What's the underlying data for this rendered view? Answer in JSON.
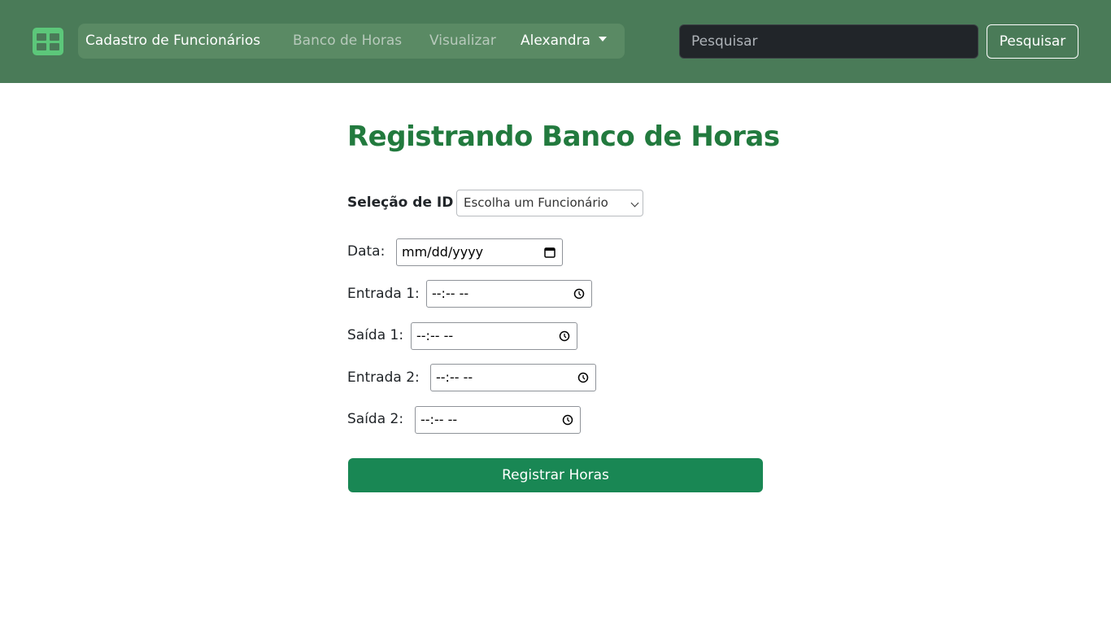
{
  "navbar": {
    "logo_icon": "table-grid-icon",
    "links": [
      {
        "label": "Cadastro de Funcionários",
        "state": "active"
      },
      {
        "label": "Banco de Horas",
        "state": "muted"
      },
      {
        "label": "Visualizar",
        "state": "muted"
      },
      {
        "label": "Alexandra",
        "state": "dropdown"
      }
    ],
    "search": {
      "placeholder": "Pesquisar",
      "button_label": "Pesquisar"
    },
    "colors": {
      "bar": "#4a7b58",
      "pill": "#5a8a64",
      "logo": "#5cc77a"
    }
  },
  "main": {
    "title": "Registrando Banco de Horas",
    "id_select": {
      "label": "Seleção de ID",
      "value": "Escolha um Funcionário"
    },
    "fields": [
      {
        "label": "Data:",
        "value": "mm/dd/yyyy",
        "icon": "calendar-icon"
      },
      {
        "label": "Entrada 1:",
        "value": "--:-- --",
        "icon": "clock-icon"
      },
      {
        "label": "Saída 1:",
        "value": "--:-- --",
        "icon": "clock-icon"
      },
      {
        "label": "Entrada 2:",
        "value": "--:-- --",
        "icon": "clock-icon"
      },
      {
        "label": "Saída 2:",
        "value": "--:-- --",
        "icon": "clock-icon"
      }
    ],
    "submit_label": "Registrar Horas",
    "colors": {
      "title": "#227a3e",
      "submit": "#198754"
    }
  }
}
